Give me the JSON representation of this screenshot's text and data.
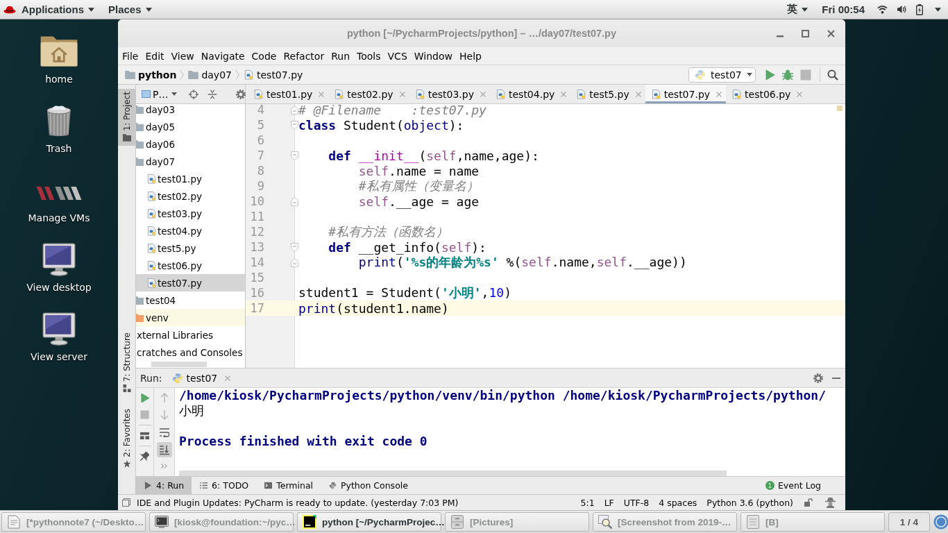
{
  "top_bar": {
    "menus": [
      "Applications",
      "Places"
    ],
    "input_method": "英",
    "clock": "Fri 00:54"
  },
  "desktop_icons": [
    {
      "label": "home",
      "kind": "home"
    },
    {
      "label": "Trash",
      "kind": "trash"
    },
    {
      "label": "Manage VMs",
      "kind": "vm"
    },
    {
      "label": "View desktop",
      "kind": "monitor"
    },
    {
      "label": "View server",
      "kind": "monitor"
    }
  ],
  "window": {
    "title": "python [~/PycharmProjects/python] – …/day07/test07.py"
  },
  "menu": [
    "File",
    "Edit",
    "View",
    "Navigate",
    "Code",
    "Refactor",
    "Run",
    "Tools",
    "VCS",
    "Window",
    "Help"
  ],
  "breadcrumbs": [
    {
      "label": "python",
      "kind": "project"
    },
    {
      "label": "day07",
      "kind": "folder"
    },
    {
      "label": "test07.py",
      "kind": "file"
    }
  ],
  "run_config": {
    "label": "test07"
  },
  "nav_actions": [
    {
      "kind": "run",
      "disabled": false
    },
    {
      "kind": "debug",
      "disabled": false
    },
    {
      "kind": "stop",
      "disabled": true
    },
    {
      "kind": "search",
      "disabled": false
    }
  ],
  "tool_strip": [
    {
      "label": "1: Project",
      "kind": "project",
      "selected": true
    },
    {
      "label": "7: Structure",
      "kind": "structure",
      "selected": false
    },
    {
      "label": "2: Favorites",
      "kind": "favorites",
      "selected": false
    }
  ],
  "project_panel": {
    "view": "P…"
  },
  "project_tree": {
    "items": [
      {
        "label": "day03",
        "kind": "folder",
        "selected": false
      },
      {
        "label": "day05",
        "kind": "folder",
        "selected": false
      },
      {
        "label": "day06",
        "kind": "folder",
        "selected": false
      },
      {
        "label": "day07",
        "kind": "folder",
        "selected": false,
        "children": [
          {
            "label": "test01.py",
            "kind": "file",
            "selected": false
          },
          {
            "label": "test02.py",
            "kind": "file",
            "selected": false
          },
          {
            "label": "test03.py",
            "kind": "file",
            "selected": false
          },
          {
            "label": "test04.py",
            "kind": "file",
            "selected": false
          },
          {
            "label": "test5.py",
            "kind": "file",
            "selected": false
          },
          {
            "label": "test06.py",
            "kind": "file",
            "selected": false
          },
          {
            "label": "test07.py",
            "kind": "file",
            "selected": true
          }
        ]
      },
      {
        "label": "test04",
        "kind": "folder",
        "selected": false
      },
      {
        "label": "venv",
        "kind": "excluded",
        "selected": false
      }
    ],
    "root_items": [
      {
        "label": "xternal Libraries",
        "selected": false
      },
      {
        "label": "cratches and Consoles",
        "selected": false
      }
    ]
  },
  "editor_tabs": [
    {
      "label": "test01.py",
      "selected": false
    },
    {
      "label": "test02.py",
      "selected": false
    },
    {
      "label": "test03.py",
      "selected": false
    },
    {
      "label": "test04.py",
      "selected": false
    },
    {
      "label": "test5.py",
      "selected": false
    },
    {
      "label": "test07.py",
      "selected": true
    },
    {
      "label": "test06.py",
      "selected": false
    }
  ],
  "editor": {
    "lines": [
      {
        "number": "4",
        "current": false,
        "fold_start": false,
        "fold_end": true,
        "tokens": [
          {
            "kind": "comment",
            "text": "# @Filename    :test07.py"
          }
        ]
      },
      {
        "number": "5",
        "current": false,
        "fold_start": true,
        "fold_end": false,
        "tokens": [
          {
            "kind": "keyword",
            "text": "class"
          },
          {
            "kind": "plain",
            "text": " Student("
          },
          {
            "kind": "builtin",
            "text": "object"
          },
          {
            "kind": "plain",
            "text": "):"
          }
        ]
      },
      {
        "number": "6",
        "current": false,
        "fold_start": false,
        "fold_end": false
      },
      {
        "number": "7",
        "current": false,
        "fold_start": true,
        "fold_end": false,
        "tokens": [
          {
            "kind": "keyword",
            "text": "    def"
          },
          {
            "kind": "magic",
            "text": " __init__"
          },
          {
            "kind": "plain",
            "text": "("
          },
          {
            "kind": "self",
            "text": "self"
          },
          {
            "kind": "plain",
            "text": ",name,age):"
          }
        ]
      },
      {
        "number": "8",
        "current": false,
        "fold_start": false,
        "fold_end": false,
        "tokens": [
          {
            "kind": "self",
            "text": "        self"
          },
          {
            "kind": "plain",
            "text": ".name = name"
          }
        ]
      },
      {
        "number": "9",
        "current": false,
        "fold_start": false,
        "fold_end": false,
        "tokens": [
          {
            "kind": "comment",
            "text": "        #私有属性（变量名）"
          }
        ]
      },
      {
        "number": "10",
        "current": false,
        "fold_start": false,
        "fold_end": true,
        "tokens": [
          {
            "kind": "self",
            "text": "        self"
          },
          {
            "kind": "plain",
            "text": ".__age = age"
          }
        ]
      },
      {
        "number": "11",
        "current": false,
        "fold_start": false,
        "fold_end": false
      },
      {
        "number": "12",
        "current": false,
        "fold_start": false,
        "fold_end": false,
        "tokens": [
          {
            "kind": "comment",
            "text": "    #私有方法（函数名）"
          }
        ]
      },
      {
        "number": "13",
        "current": false,
        "fold_start": true,
        "fold_end": false,
        "tokens": [
          {
            "kind": "keyword",
            "text": "    def"
          },
          {
            "kind": "plain",
            "text": " __get_info("
          },
          {
            "kind": "self",
            "text": "self"
          },
          {
            "kind": "plain",
            "text": "):"
          }
        ]
      },
      {
        "number": "14",
        "current": false,
        "fold_start": false,
        "fold_end": true,
        "tokens": [
          {
            "kind": "builtin",
            "text": "        print"
          },
          {
            "kind": "plain",
            "text": "("
          },
          {
            "kind": "string",
            "text": "'%s的年龄为%s'"
          },
          {
            "kind": "plain",
            "text": " %("
          },
          {
            "kind": "self",
            "text": "self"
          },
          {
            "kind": "plain",
            "text": ".name,"
          },
          {
            "kind": "self",
            "text": "self"
          },
          {
            "kind": "plain",
            "text": ".__age))"
          }
        ]
      },
      {
        "number": "15",
        "current": false,
        "fold_start": false,
        "fold_end": false
      },
      {
        "number": "16",
        "current": false,
        "fold_start": false,
        "fold_end": false,
        "tokens": [
          {
            "kind": "plain",
            "text": "student1 = Student("
          },
          {
            "kind": "string",
            "text": "'小明'"
          },
          {
            "kind": "plain",
            "text": ","
          },
          {
            "kind": "number",
            "text": "10"
          },
          {
            "kind": "plain",
            "text": ")"
          }
        ]
      },
      {
        "number": "17",
        "current": true,
        "fold_start": false,
        "fold_end": false,
        "tokens": [
          {
            "kind": "builtin",
            "text": "print"
          },
          {
            "kind": "plain",
            "text": "(student1.name)"
          }
        ]
      }
    ]
  },
  "run_panel": {
    "label": "Run:",
    "tab": "test07",
    "actions": [
      {
        "kind": "rerun",
        "disabled": false
      },
      {
        "kind": "stop",
        "disabled": true
      },
      {
        "kind": "layout",
        "disabled": false
      },
      {
        "kind": "pin",
        "disabled": false
      }
    ],
    "tools": [
      {
        "kind": "up",
        "disabled": true,
        "on": false
      },
      {
        "kind": "down",
        "disabled": true,
        "on": false
      },
      {
        "kind": "wrap",
        "disabled": false,
        "on": false
      },
      {
        "kind": "scroll-end",
        "disabled": false,
        "on": true
      }
    ],
    "output": [
      {
        "kind": "system",
        "text": "/home/kiosk/PycharmProjects/python/venv/bin/python /home/kiosk/PycharmProjects/python/"
      },
      {
        "kind": "stdout",
        "text": "小明"
      },
      {
        "kind": "exit",
        "text": "Process finished with exit code 0"
      }
    ]
  },
  "bottom_tabs": [
    {
      "label": "4: Run",
      "kind": "run",
      "selected": true
    },
    {
      "label": "6: TODO",
      "kind": "todo",
      "selected": false
    },
    {
      "label": "Terminal",
      "kind": "terminal",
      "selected": false
    },
    {
      "label": "Python Console",
      "kind": "console",
      "selected": false
    }
  ],
  "event_log": {
    "label": "Event Log",
    "count": "1"
  },
  "status_bar": {
    "message": "IDE and Plugin Updates: PyCharm is ready to update. (yesterday 7:03 PM)",
    "items": [
      "5:1",
      "LF",
      "UTF-8",
      "4 spaces",
      "Python 3.6 (python)"
    ]
  },
  "taskbar": {
    "items": [
      {
        "label": "[*pythonnote7 (~/Deskto…",
        "kind": "editor",
        "minimized": true
      },
      {
        "label": "[kiosk@foundation:~/pyc…",
        "kind": "terminal",
        "minimized": true
      },
      {
        "label": "python [~/PycharmProjec…",
        "kind": "ide",
        "minimized": false
      },
      {
        "label": "[Pictures]",
        "kind": "files",
        "minimized": true
      },
      {
        "label": "[Screenshot from 2019-…",
        "kind": "screenshot",
        "minimized": true
      },
      {
        "label": "[B]",
        "kind": "document",
        "minimized": true
      }
    ],
    "pager": "1 / 4"
  }
}
